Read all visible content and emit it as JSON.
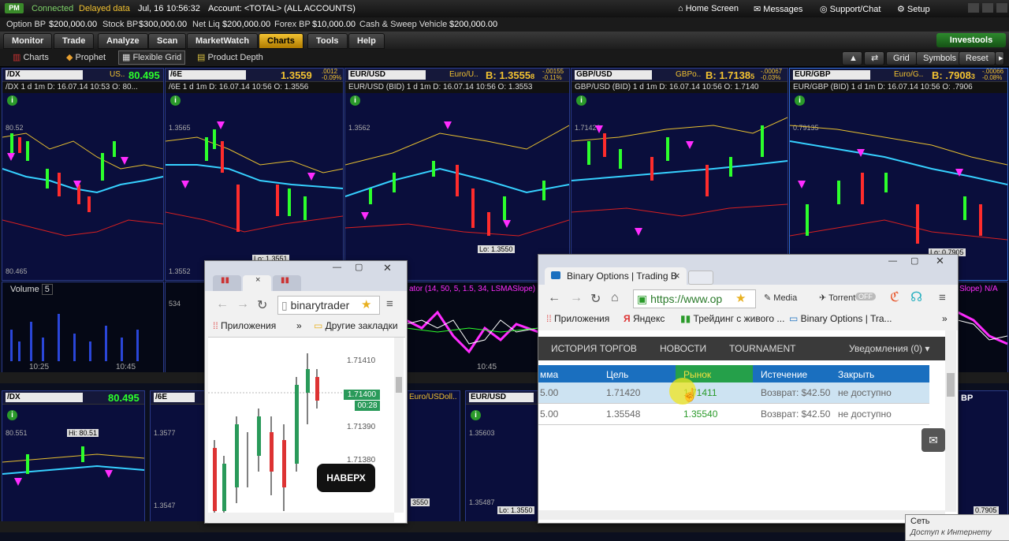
{
  "topbar": {
    "pm": "PM",
    "connected": "Connected",
    "delayed": "Delayed data",
    "date": "Jul, 16",
    "time": "10:56:32",
    "account": "Account: <TOTAL> (ALL ACCOUNTS)",
    "home": "Home Screen",
    "messages": "Messages",
    "support": "Support/Chat",
    "setup": "Setup"
  },
  "infobar": {
    "option_bp": "Option BP",
    "option_bp_v": "$200,000.00",
    "stock_bp": "Stock BP",
    "stock_bp_v": "$300,000.00",
    "net_liq": "Net Liq",
    "net_liq_v": "$200,000.00",
    "forex_bp": "Forex BP",
    "forex_bp_v": "$10,000.00",
    "cash": "Cash & Sweep Vehicle",
    "cash_v": "$200,000.00"
  },
  "nav": {
    "tabs": [
      "Monitor",
      "Trade",
      "Analyze",
      "Scan",
      "MarketWatch",
      "Charts",
      "Tools",
      "Help"
    ],
    "investools": "Investools"
  },
  "subbar": {
    "charts": "Charts",
    "prophet": "Prophet",
    "flexible": "Flexible Grid",
    "depth": "Product Depth",
    "grid": "Grid",
    "symbols": "Symbols",
    "reset": "Reset"
  },
  "panels": [
    {
      "symbol": "/DX",
      "desc": "US..",
      "value": "80.495",
      "info": "/DX 1 d 1m",
      "date": "D: 16.07.14 10:53",
      "open": "O: 80...",
      "p1": "80.52",
      "p2": "80.465"
    },
    {
      "symbol": "/6E",
      "desc": "",
      "value": "1.3559",
      "change": ".0012",
      "changepct": "-0.09%",
      "info": "/6E 1 d 1m",
      "date": "D: 16.07.14 10:56",
      "open": "O: 1.3556",
      "p1": "1.3565",
      "p2": "1.3552",
      "lo": "Lo: 1.3551"
    },
    {
      "symbol": "EUR/USD",
      "desc": "Euro/U..",
      "value": "B: 1.3555",
      "valsuffix": "8",
      "change": "-.00155",
      "changepct": "-0.11%",
      "info": "EUR/USD (BID) 1 d 1m",
      "date": "D: 16.07.14 10:56",
      "open": "O: 1.3553",
      "p1": "1.3562",
      "lo": "Lo: 1.3550"
    },
    {
      "symbol": "GBP/USD",
      "desc": "GBPo..",
      "value": "B: 1.7138",
      "valsuffix": "5",
      "change": "-.00067",
      "changepct": "-0.03%",
      "info": "GBP/USD (BID) 1 d 1m",
      "date": "D: 16.07.14 10:56",
      "open": "O: 1.7140",
      "p1": "1.71426"
    },
    {
      "symbol": "EUR/GBP",
      "desc": "Euro/G..",
      "value": "B: .7908",
      "valsuffix": "3",
      "change": "-.00066",
      "changepct": "-0.08%",
      "info": "EUR/GBP (BID) 1 d 1m",
      "date": "D: 16.07.14 10:56",
      "open": "O: .7906",
      "p1": "0.79135",
      "lo": "Lo: 0.7905"
    }
  ],
  "volume": {
    "label": "Volume",
    "value": "5",
    "time1": "10:25",
    "time2": "10:45",
    "v2": "534"
  },
  "indicator": {
    "label": "ator (14, 50, 5, 1.5, 34, LSMASlope)",
    "label2": "Slope)",
    "na": "N/A",
    "time": "10:45"
  },
  "bottom": [
    {
      "symbol": "/DX",
      "value": "80.495",
      "p1": "80.551",
      "hi": "Hi: 80.51"
    },
    {
      "symbol": "/6E",
      "p1": "1.3577",
      "p2": "1.3547"
    },
    {
      "symbol": "",
      "desc": "Euro/USDoll..",
      "lo": "3550"
    },
    {
      "symbol": "EUR/USD",
      "p1": "1.35603",
      "p2": "1.35487",
      "lo": "Lo: 1.3550"
    },
    {
      "symbol": "BP",
      "lo": "0.7905"
    }
  ],
  "chrome_small": {
    "url": "binarytrader",
    "apps": "Приложения",
    "more": "»",
    "other": "Другие закладки",
    "prices": [
      "1.71410",
      "1.71400",
      "00:28",
      "1.71390",
      "1.71380"
    ],
    "button": "НАВЕРХ"
  },
  "chrome_main": {
    "tab": "Binary Options | Trading B",
    "url": "https://www.op",
    "media": "Media",
    "torrent": "Torrent",
    "off": "OFF",
    "bookmarks": [
      "Приложения",
      "Яндекс",
      "Трейдинг с живого ...",
      "Binary Options | Tra..."
    ],
    "more": "»",
    "nav": [
      "ИСТОРИЯ ТОРГОВ",
      "НОВОСТИ",
      "TOURNAMENT"
    ],
    "notifications": "Уведомления (0)",
    "columns": [
      "мма",
      "Цель",
      "Рынок",
      "Истечение",
      "Закрыть"
    ],
    "rows": [
      {
        "amount": "5.00",
        "target": "1.71420",
        "market": "1.71411",
        "expiry": "Возврат: $42.50",
        "close": "не доступно"
      },
      {
        "amount": "5.00",
        "target": "1.35548",
        "market": "1.35540",
        "expiry": "Возврат: $42.50",
        "close": "не доступно"
      }
    ]
  },
  "tray": {
    "network": "Сеть",
    "status": "Доступ к Интернету"
  },
  "colors": {
    "green": "#2cff2c",
    "magenta": "#ff2cff",
    "cyan": "#36d0ff",
    "yellow": "#f2c231",
    "blue_head": "#1a6fbf"
  }
}
